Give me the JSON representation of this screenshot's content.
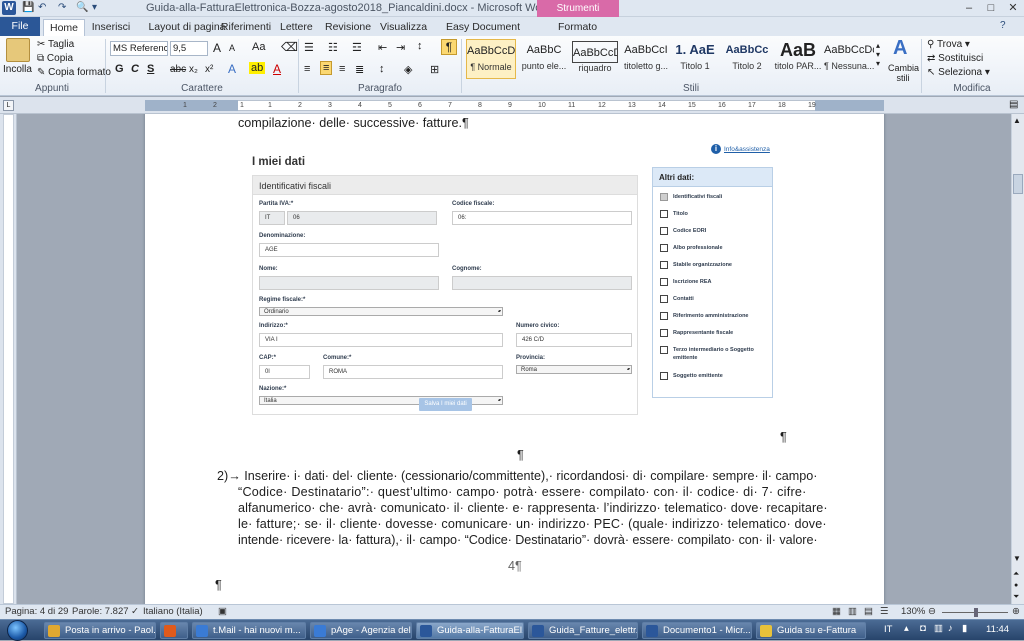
{
  "window": {
    "title": "Guida-alla-FatturaElettronica-Bozza-agosto2018_Piancaldini.docx - Microsoft Word",
    "context_tab": "Strumenti immagine",
    "buttons": {
      "minimize": "–",
      "maximize": "□",
      "close": "✕"
    }
  },
  "tabs": {
    "file": "File",
    "home": "Home",
    "inserisci": "Inserisci",
    "layout": "Layout di pagina",
    "riferimenti": "Riferimenti",
    "lettere": "Lettere",
    "revisione": "Revisione",
    "visualizza": "Visualizza",
    "easydoc": "Easy Document Creator",
    "formato": "Formato"
  },
  "ribbon": {
    "appunti": {
      "label": "Appunti",
      "incolla": "Incolla",
      "taglia": "Taglia",
      "copia": "Copia",
      "copia_formato": "Copia formato"
    },
    "carattere": {
      "label": "Carattere",
      "font": "MS Reference",
      "size": "9,5",
      "grow": "A",
      "shrink": "A",
      "case": "Aa",
      "bold": "G",
      "italic": "C",
      "underline": "S",
      "strike": "abc",
      "sub": "x₂",
      "sup": "x²"
    },
    "paragrafo": {
      "label": "Paragrafo",
      "pilcrow": "¶"
    },
    "stili": {
      "label": "Stili",
      "items": [
        {
          "preview": "AaBbCcDc",
          "name": "¶ Normale"
        },
        {
          "preview": "AaBbC",
          "name": "punto ele..."
        },
        {
          "preview": "AaBbCcD",
          "name": "riquadro"
        },
        {
          "preview": "AaBbCcI",
          "name": "titoletto g..."
        },
        {
          "preview": "1.  AaE",
          "name": "Titolo 1"
        },
        {
          "preview": "AaBbCc",
          "name": "Titolo 2"
        },
        {
          "preview": "AaB",
          "name": "titolo PAR..."
        },
        {
          "preview": "AaBbCcDc",
          "name": "¶ Nessuna..."
        }
      ],
      "cambia_stili": "Cambia stili"
    },
    "modifica": {
      "label": "Modifica",
      "trova": "Trova",
      "sostituisci": "Sostituisci",
      "seleziona": "Seleziona"
    }
  },
  "ruler": {
    "ticks": [
      "1",
      "2",
      "1",
      "1",
      "2",
      "3",
      "4",
      "5",
      "6",
      "7",
      "8",
      "9",
      "10",
      "11",
      "12",
      "13",
      "14",
      "15",
      "16",
      "17",
      "18",
      "19"
    ]
  },
  "document": {
    "line_top": "compilazione· delle· successive· fatture.¶",
    "pilcrow_mid": "¶",
    "pilcrow_right": "¶",
    "item2": [
      "2)→ Inserire· i· dati· del· cliente· (cessionario/committente),· ricordandosi· di· compilare· sempre· il· campo·",
      "“Codice· Destinatario”:· quest’ultimo· campo· potrà· essere· compilato· con· il· codice· di· 7· cifre·",
      "alfanumerico· che· avrà· comunicato· il· cliente· e· rappresenta· l’indirizzo· telematico· dove· recapitare·",
      "le· fatture;· se· il· cliente· dovesse· comunicare· un· indirizzo· PEC· (quale· indirizzo· telematico· dove·",
      "intende· ricevere· la· fattura),· il· campo· “Codice· Destinatario”· dovrà· essere· compilato· con· il· valore·"
    ],
    "page_number": "4¶",
    "pilcrow_bottom": "¶"
  },
  "embedded_form": {
    "title": "I miei dati",
    "help": "Info&assistenza",
    "panel_title": "Identificativi fiscali",
    "fields": {
      "partita_iva_label": "Partita IVA:*",
      "partita_iva_country": "IT",
      "partita_iva_value": "06",
      "codice_fiscale_label": "Codice fiscale:",
      "codice_fiscale_value": "06:",
      "denominazione_label": "Denominazione:",
      "denominazione_value": "AGE",
      "nome_label": "Nome:",
      "cognome_label": "Cognome:",
      "regime_label": "Regime fiscale:*",
      "regime_value": "Ordinario",
      "indirizzo_label": "Indirizzo:*",
      "indirizzo_value": "VIA I",
      "civico_label": "Numero civico:",
      "civico_value": "426 C/D",
      "cap_label": "CAP:*",
      "cap_value": "0l",
      "comune_label": "Comune:*",
      "comune_value": "ROMA",
      "provincia_label": "Provincia:",
      "provincia_value": "Roma",
      "nazione_label": "Nazione:*",
      "nazione_value": "Italia"
    },
    "save_button": "Salva I miei dati",
    "altri_dati": {
      "title": "Altri dati:",
      "items": [
        {
          "label": "Identificativi fiscali",
          "checked": true
        },
        {
          "label": "Titolo",
          "checked": false
        },
        {
          "label": "Codice EORI",
          "checked": false
        },
        {
          "label": "Albo professionale",
          "checked": false
        },
        {
          "label": "Stabile organizzazione",
          "checked": false
        },
        {
          "label": "Iscrizione REA",
          "checked": false
        },
        {
          "label": "Contatti",
          "checked": false
        },
        {
          "label": "Riferimento amministrazione",
          "checked": false
        },
        {
          "label": "Rappresentante fiscale",
          "checked": false
        },
        {
          "label": "Terzo intermediario o Soggetto emittente",
          "checked": false
        },
        {
          "label": "Soggetto emittente",
          "checked": false
        }
      ]
    }
  },
  "statusbar": {
    "pagina": "Pagina: 4 di 29",
    "parole": "Parole: 7.827",
    "lingua": "Italiano (Italia)",
    "zoom": "130%"
  },
  "taskbar": {
    "items": [
      {
        "label": "Posta in arrivo - Paol...",
        "color": "#e0a830"
      },
      {
        "label": "",
        "color": "#e05a1b"
      },
      {
        "label": "t.Mail - hai nuovi m...",
        "color": "#3a7bd5"
      },
      {
        "label": "pAge - Agenzia dell...",
        "color": "#3a7bd5"
      },
      {
        "label": "Guida-alla-FatturaEl...",
        "color": "#2b579a"
      },
      {
        "label": "Guida_Fatture_elettr...",
        "color": "#2b579a"
      },
      {
        "label": "Documento1 - Micr...",
        "color": "#2b579a"
      },
      {
        "label": "Guida su e-Fattura",
        "color": "#e8c23a"
      }
    ],
    "lang": "IT",
    "time": "11:44"
  }
}
